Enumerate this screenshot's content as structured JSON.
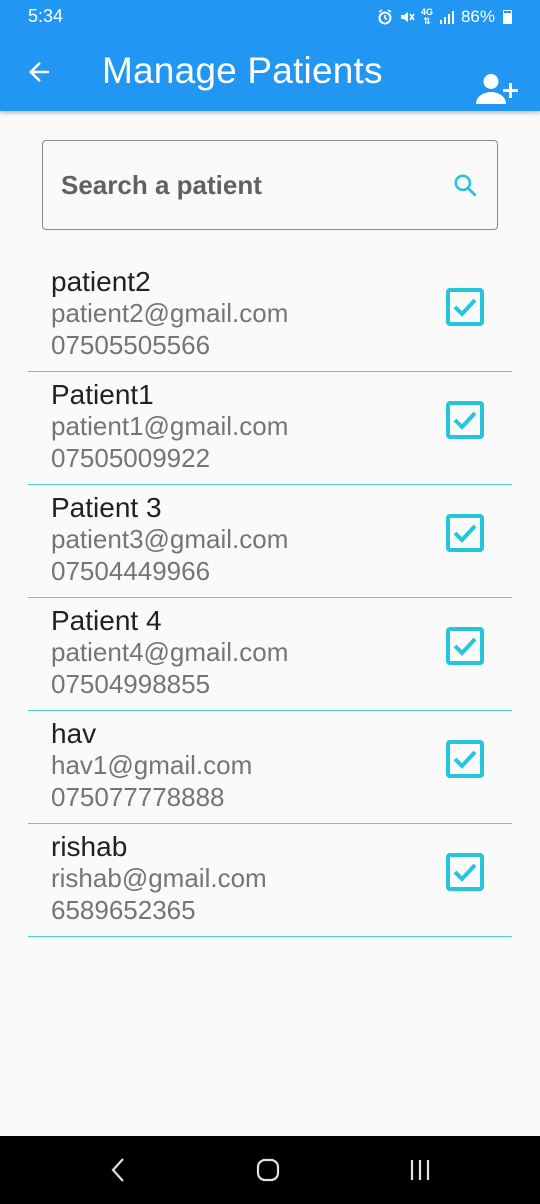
{
  "status_bar": {
    "time": "5:34",
    "network": "4G",
    "battery": "86%",
    "icons": [
      "alarm-icon",
      "mute-icon",
      "data-icon",
      "signal-icon",
      "battery-icon"
    ]
  },
  "app_bar": {
    "title": "Manage Patients",
    "color": "#2196f3",
    "back_icon": "arrow-back-icon",
    "add_icon": "person-add-icon"
  },
  "search": {
    "placeholder": "Search a patient",
    "value": "",
    "icon": "search-icon"
  },
  "patients": [
    {
      "name": "patient2",
      "email": "patient2@gmail.com",
      "phone": "07505505566",
      "checked": true
    },
    {
      "name": "Patient1",
      "email": "patient1@gmail.com",
      "phone": "07505009922",
      "checked": true
    },
    {
      "name": "Patient 3",
      "email": "patient3@gmail.com",
      "phone": "07504449966",
      "checked": true
    },
    {
      "name": "Patient 4",
      "email": "patient4@gmail.com",
      "phone": "07504998855",
      "checked": true
    },
    {
      "name": "hav",
      "email": "hav1@gmail.com",
      "phone": "075077778888",
      "checked": true
    },
    {
      "name": "rishab",
      "email": "rishab@gmail.com",
      "phone": "6589652365",
      "checked": true
    }
  ],
  "accent_color": "#26c6da",
  "nav_bar": {
    "icons": [
      "back-nav-icon",
      "home-nav-icon",
      "recents-nav-icon"
    ]
  }
}
